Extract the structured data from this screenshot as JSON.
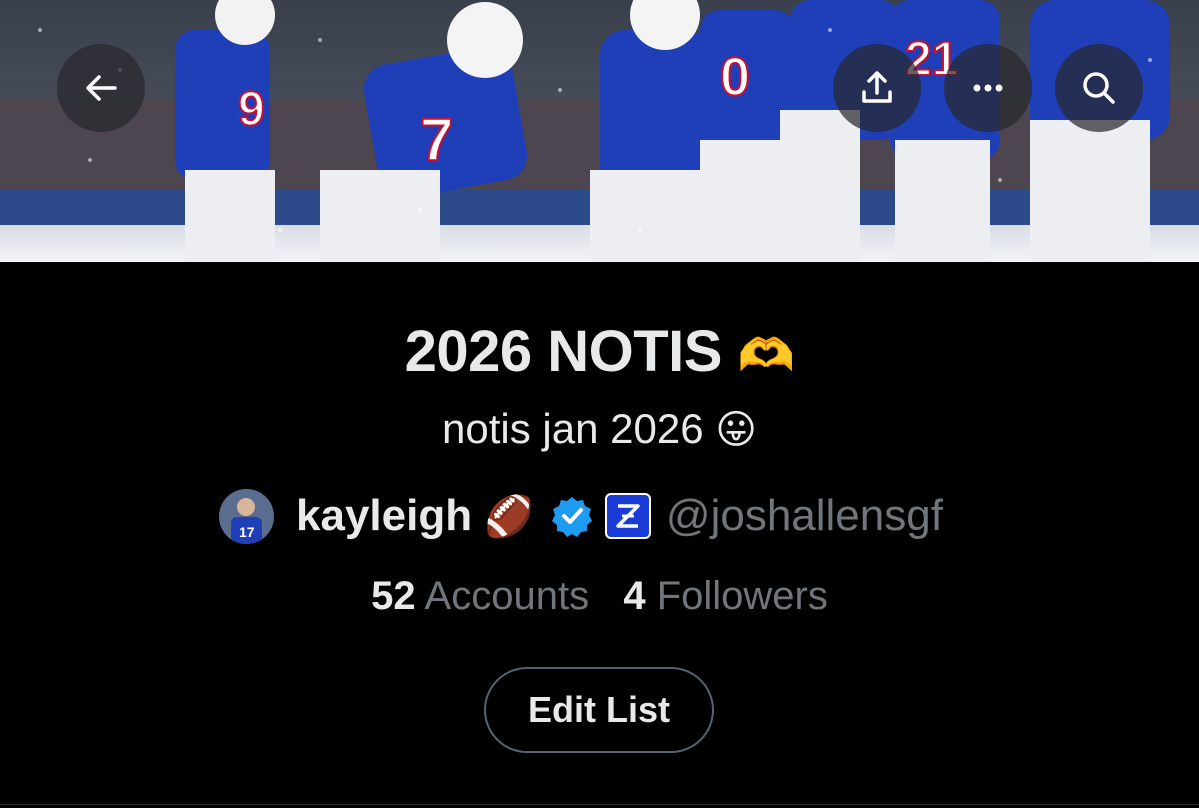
{
  "header": {
    "back_icon": "arrow-left-icon",
    "share_icon": "share-upload-icon",
    "more_icon": "more-horizontal-icon",
    "search_icon": "search-icon",
    "banner_image": "football-team-celebration-snow"
  },
  "list": {
    "title": "2026 NOTIS",
    "title_emoji": "🫶",
    "description": "notis jan 2026",
    "description_emoji": "😛",
    "owner": {
      "name": "kayleigh",
      "name_emoji": "🏈",
      "handle": "@joshallensgf",
      "verified_icon": "verified-badge-icon",
      "affiliation_icon": "affiliation-badge-icon"
    },
    "stats": {
      "accounts_count": "52",
      "accounts_label": "Accounts",
      "followers_count": "4",
      "followers_label": "Followers"
    },
    "edit_label": "Edit List"
  },
  "colors": {
    "background": "#000000",
    "text_primary": "#e7e9ea",
    "text_secondary": "#71767b",
    "verified_blue": "#1d9bf0",
    "button_border": "#536471"
  }
}
